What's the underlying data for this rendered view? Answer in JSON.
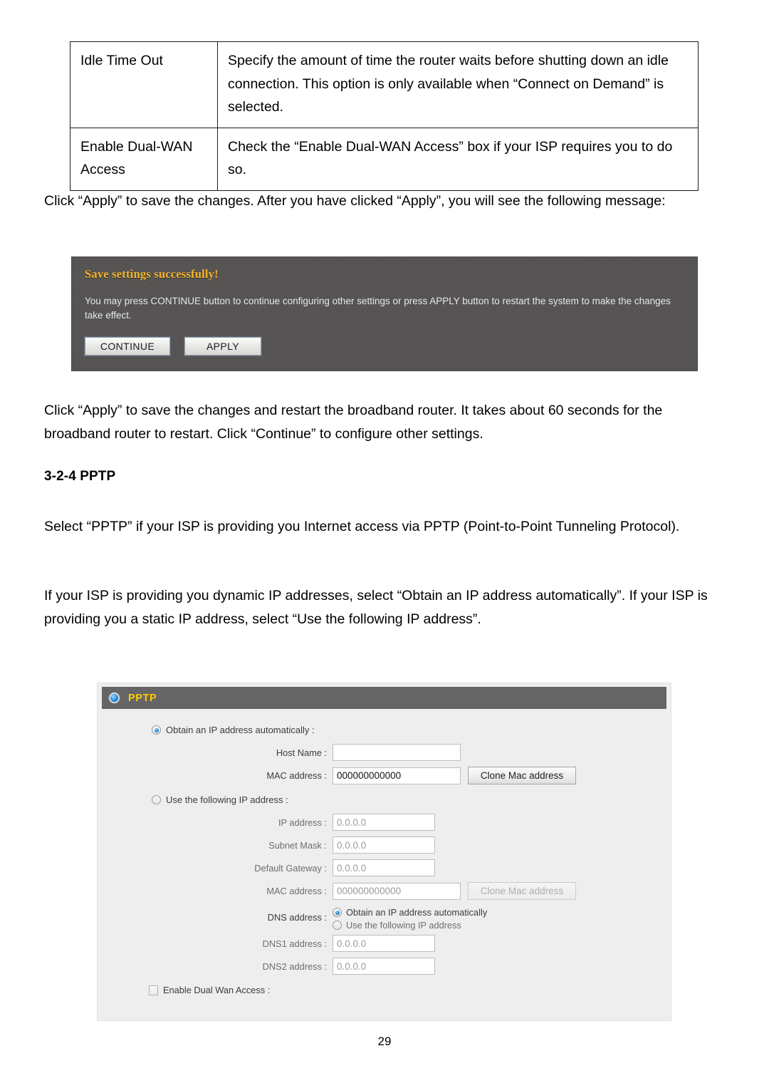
{
  "document": {
    "page_number": "29",
    "section_heading": "3-2-4 PPTP"
  },
  "settings_table": {
    "rows": [
      {
        "label": "Idle Time Out",
        "description": "Specify the amount of time the router waits before shutting down an idle connection. This option is only available when “Connect on Demand” is selected."
      },
      {
        "label": "Enable Dual-WAN Access",
        "description": "Check the “Enable Dual-WAN Access” box if your ISP requires you to do so."
      }
    ]
  },
  "paragraphs": {
    "apply_intro": "Click “Apply” to save the changes. After you have clicked “Apply”, you will see the following message:",
    "restart_note": "Click “Apply” to save the changes and restart the broadband router. It takes about 60 seconds for the broadband router to restart. Click “Continue” to configure other settings.",
    "select_pptp": "Select “PPTP” if your ISP is providing you Internet access via PPTP (Point-to-Point Tunneling Protocol).",
    "dynamic_static": "If your ISP is providing you dynamic IP addresses, select “Obtain an IP address automatically”. If your ISP is providing you a static IP address, select “Use the following IP address”."
  },
  "save_dialog": {
    "title": "Save settings successfully!",
    "message": "You may press CONTINUE button to continue configuring other settings or press APPLY button to restart the system to make the changes take effect.",
    "continue_button": "CONTINUE",
    "apply_button": "APPLY",
    "background_color": "#555252",
    "title_color": "#f0b429"
  },
  "pptp_form": {
    "header_title": "PPTP",
    "header_color": "#656565",
    "header_title_color": "#ffcc00",
    "auto_section": {
      "radio_label": "Obtain an IP address automatically :",
      "selected": true,
      "host_name_label": "Host Name :",
      "host_name_value": "",
      "mac_label": "MAC address :",
      "mac_value": "000000000000",
      "clone_button": "Clone Mac address"
    },
    "static_section": {
      "radio_label": "Use the following IP address :",
      "selected": false,
      "fields": [
        {
          "label": "IP address :",
          "value": "0.0.0.0"
        },
        {
          "label": "Subnet Mask :",
          "value": "0.0.0.0"
        },
        {
          "label": "Default Gateway :",
          "value": "0.0.0.0"
        }
      ],
      "mac_label": "MAC address :",
      "mac_value": "000000000000",
      "clone_button": "Clone Mac address"
    },
    "dns_section": {
      "label": "DNS address :",
      "option_auto": "Obtain an IP address automatically",
      "option_manual": "Use the following IP address",
      "auto_selected": true,
      "dns1_label": "DNS1 address :",
      "dns1_value": "0.0.0.0",
      "dns2_label": "DNS2 address :",
      "dns2_value": "0.0.0.0"
    },
    "dual_wan": {
      "label": "Enable Dual Wan Access :",
      "checked": false
    }
  }
}
